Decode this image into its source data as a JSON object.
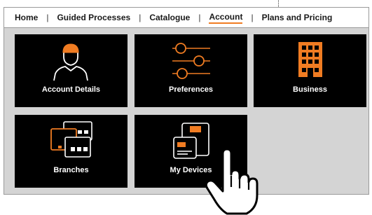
{
  "nav": {
    "items": [
      {
        "label": "Home",
        "active": false
      },
      {
        "label": "Guided Processes",
        "active": false
      },
      {
        "label": "Catalogue",
        "active": false
      },
      {
        "label": "Account",
        "active": true
      },
      {
        "label": "Plans and Pricing",
        "active": false
      }
    ],
    "separator": "|"
  },
  "tiles": [
    {
      "label": "Account Details",
      "icon": "user-icon"
    },
    {
      "label": "Preferences",
      "icon": "sliders-icon"
    },
    {
      "label": "Business",
      "icon": "building-icon"
    },
    {
      "label": "Branches",
      "icon": "branches-icon"
    },
    {
      "label": "My Devices",
      "icon": "devices-icon"
    }
  ],
  "colors": {
    "accent": "#f07c22",
    "tile_bg": "#000000",
    "panel_bg": "#d4d4d4"
  }
}
